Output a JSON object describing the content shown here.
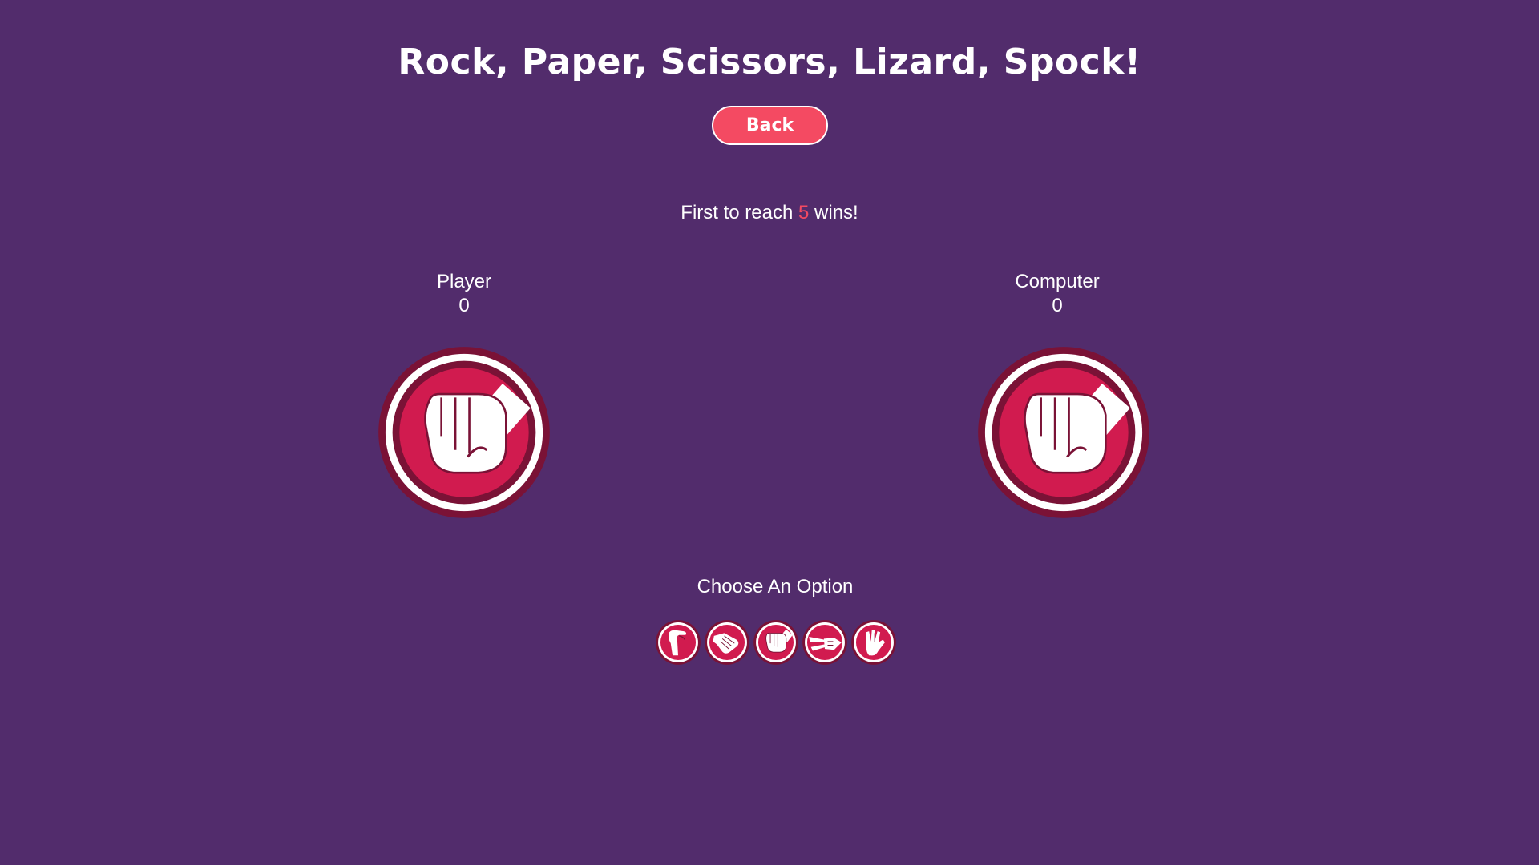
{
  "title": "Rock, Paper, Scissors, Lizard, Spock!",
  "back_button": "Back",
  "rules": {
    "prefix": "First to reach",
    "target": "5",
    "suffix": "wins!"
  },
  "player": {
    "label": "Player",
    "score": "0",
    "choice_icon": "rock-icon"
  },
  "computer": {
    "label": "Computer",
    "score": "0",
    "choice_icon": "rock-icon"
  },
  "choose_label": "Choose An Option",
  "options": [
    {
      "icon": "lizard-icon"
    },
    {
      "icon": "paper-icon"
    },
    {
      "icon": "rock-icon"
    },
    {
      "icon": "scissors-icon"
    },
    {
      "icon": "spock-icon"
    }
  ],
  "colors": {
    "background": "#522c6c",
    "accent": "#f44a62",
    "badge_outer": "#7a1236",
    "badge_inner": "#d11b4f",
    "hand": "#ffffff"
  }
}
